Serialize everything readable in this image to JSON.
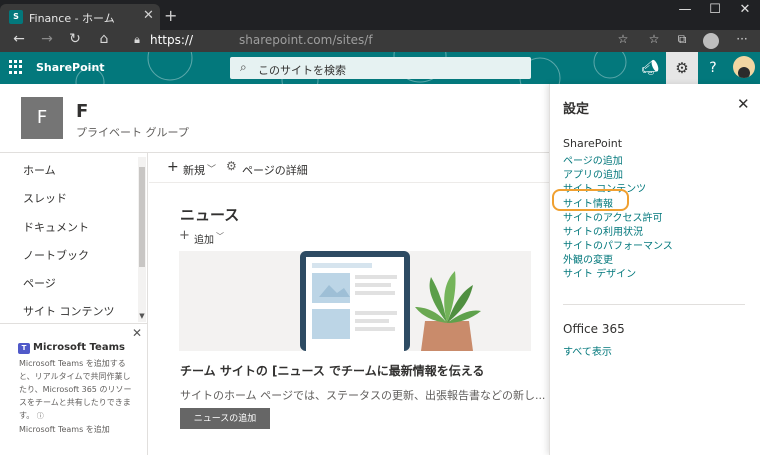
{
  "browser": {
    "tab_title": "Finance - ホーム",
    "favicon_text": "S",
    "url_host": "https://",
    "url_domain": "sharepoint.com/sites/f",
    "url_path": ""
  },
  "suite": {
    "app_name": "SharePoint",
    "search_placeholder": "このサイトを検索"
  },
  "site": {
    "logo_letter": "F",
    "name": "F",
    "subtitle": "プライベート グループ"
  },
  "left_nav": {
    "items": [
      "ホーム",
      "スレッド",
      "ドキュメント",
      "ノートブック",
      "ページ",
      "サイト コンテンツ"
    ]
  },
  "teams_promo": {
    "icon_text": "T",
    "title": "Microsoft Teams",
    "body": "Microsoft Teams を追加すると、リアルタイムで共同作業したり、Microsoft 365 のリソースをチームと共有したりできます。",
    "info": "ⓘ",
    "link": "Microsoft Teams を追加"
  },
  "command_bar": {
    "new_label": "新規",
    "details_label": "ページの詳細"
  },
  "news": {
    "title": "ニュース",
    "add_label": "追加",
    "headline": "チーム サイトの [ニュース でチームに最新情報を伝える",
    "description": "サイトのホーム ページでは、ステータスの更新、出張報告書などの新し...",
    "button_label": "ニュースの追加"
  },
  "settings": {
    "title": "設定",
    "sharepoint_heading": "SharePoint",
    "links": [
      "ページの追加",
      "アプリの追加",
      "サイト コンテンツ",
      "サイト情報",
      "サイトのアクセス許可",
      "サイトの利用状況",
      "サイトのパフォーマンス",
      "外観の変更",
      "サイト デザイン"
    ],
    "highlighted_link": "サイト情報",
    "office_heading": "Office 365",
    "office_link": "すべて表示"
  },
  "colors": {
    "brand": "#03787c",
    "highlight": "#f0a030",
    "teams": "#5059c9"
  }
}
